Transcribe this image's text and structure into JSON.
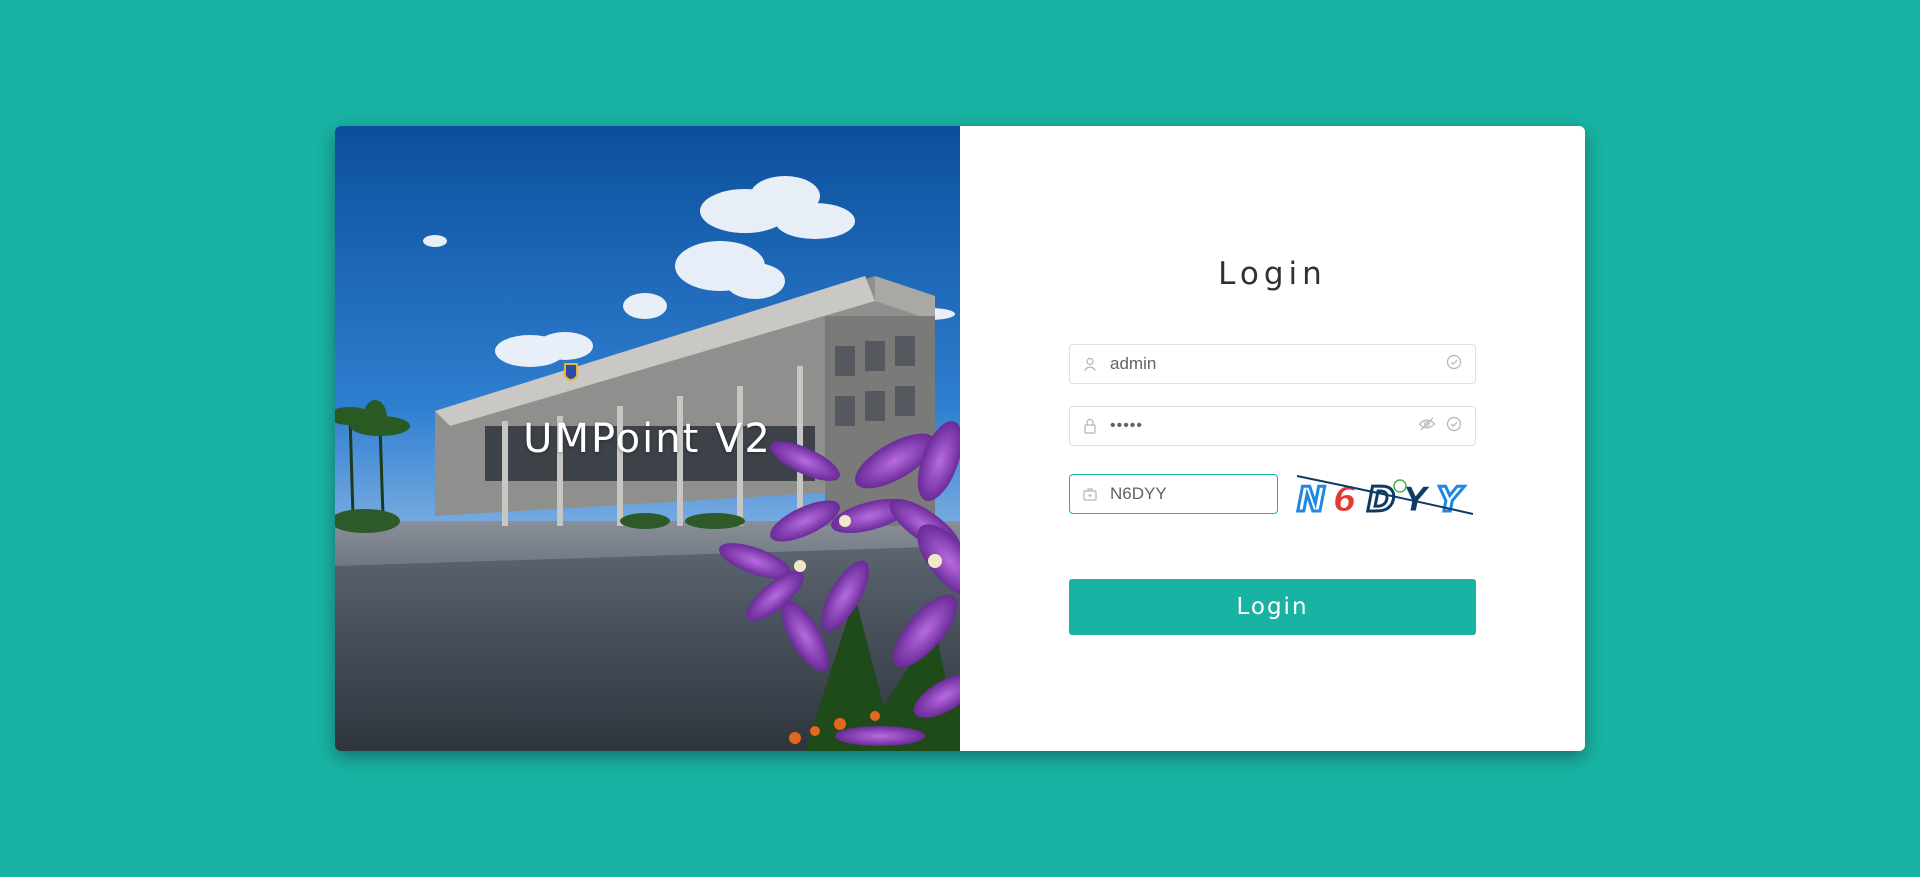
{
  "hero": {
    "title": "UMPoint V2"
  },
  "login": {
    "title": "Login",
    "username": {
      "value": "admin",
      "icon": "user-icon",
      "status_icon": "check-circle-icon"
    },
    "password": {
      "value": "•••••",
      "icon": "lock-icon",
      "toggle_icon": "eye-off-icon",
      "status_icon": "check-circle-icon"
    },
    "captcha_input": {
      "value": "N6DYY",
      "icon": "briefcase-icon"
    },
    "captcha_image": {
      "characters": [
        "N",
        "6",
        "D",
        "Y",
        "Y"
      ]
    },
    "button_label": "Login"
  },
  "colors": {
    "background": "#19b3a3",
    "accent": "#19b3a3",
    "panel": "#ffffff",
    "captcha_colors": [
      "#1e88e5",
      "#e53935",
      "#0d3b66",
      "#0d3b66",
      "#1e88e5"
    ]
  }
}
